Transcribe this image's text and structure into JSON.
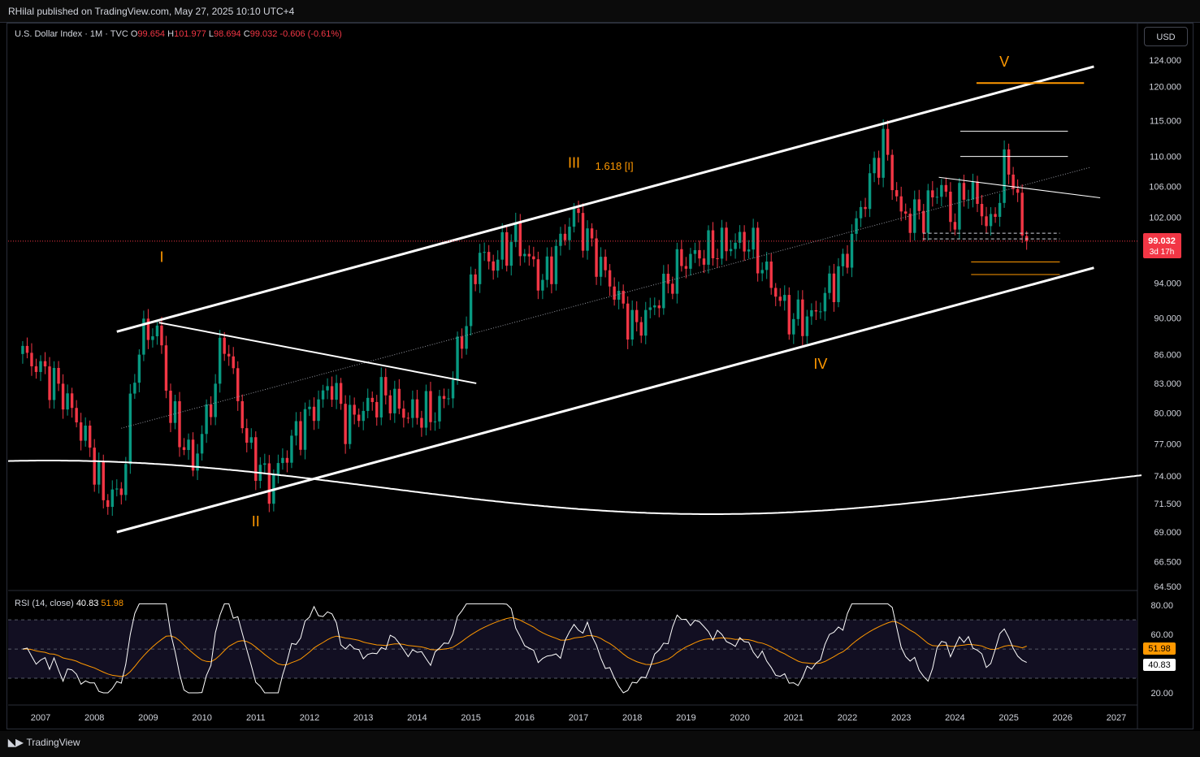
{
  "header": {
    "publisher_text": "RHilal published on TradingView.com, May 27, 2025 10:10 UTC+4"
  },
  "legend": {
    "symbol": "U.S. Dollar Index · 1M · TVC",
    "open_label": "O",
    "open": "99.654",
    "high_label": "H",
    "high": "101.977",
    "low_label": "L",
    "low": "98.694",
    "close_label": "C",
    "close": "99.032",
    "change": "-0.606 (-0.61%)"
  },
  "currency_button": "USD",
  "price_tag": {
    "value": "99.032",
    "countdown": "3d 17h"
  },
  "rsi_legend": {
    "label": "RSI (14, close)",
    "rsi": "40.83",
    "ma": "51.98"
  },
  "rsi_tags": {
    "ma": "51.98",
    "rsi": "40.83"
  },
  "footer": {
    "brand": "TradingView"
  },
  "colors": {
    "up": "#089981",
    "down": "#f23645",
    "wave": "#ff9800",
    "rsi": "#ffffff",
    "rsi_ma": "#ff9800",
    "background": "#000000"
  },
  "chart_data": {
    "type": "candlestick",
    "symbol": "U.S. Dollar Index",
    "timeframe": "1M",
    "y_scale": "log",
    "ylim": [
      64.5,
      126
    ],
    "price_ticks": [
      "124.000",
      "120.000",
      "115.000",
      "110.000",
      "106.000",
      "102.000",
      "98.000",
      "94.000",
      "90.000",
      "86.000",
      "83.000",
      "80.000",
      "77.000",
      "74.000",
      "71.500",
      "69.000",
      "66.500",
      "64.500"
    ],
    "x_ticks": [
      "2007",
      "2008",
      "2009",
      "2010",
      "2011",
      "2012",
      "2013",
      "2014",
      "2015",
      "2016",
      "2017",
      "2018",
      "2019",
      "2020",
      "2021",
      "2022",
      "2023",
      "2024",
      "2025",
      "2026",
      "2027"
    ],
    "last_price": 99.032,
    "price_path": [
      [
        "2006-09",
        86.0
      ],
      [
        "2007-01",
        84.5
      ],
      [
        "2007-06",
        82.0
      ],
      [
        "2007-12",
        76.5
      ],
      [
        "2008-03",
        72.0
      ],
      [
        "2008-07",
        72.5
      ],
      [
        "2008-11",
        87.5
      ],
      [
        "2009-03",
        89.0
      ],
      [
        "2009-06",
        80.0
      ],
      [
        "2009-11",
        75.0
      ],
      [
        "2010-03",
        81.0
      ],
      [
        "2010-06",
        88.0
      ],
      [
        "2010-11",
        77.0
      ],
      [
        "2011-04",
        73.0
      ],
      [
        "2011-10",
        78.0
      ],
      [
        "2012-06",
        83.0
      ],
      [
        "2012-09",
        79.0
      ],
      [
        "2013-06",
        82.0
      ],
      [
        "2013-10",
        80.0
      ],
      [
        "2014-05",
        80.0
      ],
      [
        "2014-08",
        82.0
      ],
      [
        "2014-12",
        90.0
      ],
      [
        "2015-03",
        98.0
      ],
      [
        "2015-05",
        96.0
      ],
      [
        "2015-11",
        99.5
      ],
      [
        "2016-05",
        94.0
      ],
      [
        "2016-12",
        102.5
      ],
      [
        "2017-06",
        96.0
      ],
      [
        "2018-01",
        89.0
      ],
      [
        "2018-04",
        90.0
      ],
      [
        "2018-12",
        96.5
      ],
      [
        "2019-09",
        98.5
      ],
      [
        "2020-03",
        99.0
      ],
      [
        "2020-12",
        90.0
      ],
      [
        "2021-05",
        90.0
      ],
      [
        "2021-12",
        96.0
      ],
      [
        "2022-04",
        103.0
      ],
      [
        "2022-09",
        112.0
      ],
      [
        "2023-01",
        102.0
      ],
      [
        "2023-06",
        102.5
      ],
      [
        "2023-10",
        106.5
      ],
      [
        "2023-12",
        101.5
      ],
      [
        "2024-04",
        106.0
      ],
      [
        "2024-09",
        100.5
      ],
      [
        "2024-12",
        108.0
      ],
      [
        "2025-01",
        109.0
      ],
      [
        "2025-03",
        104.0
      ],
      [
        "2025-04",
        99.5
      ],
      [
        "2025-05",
        99.032
      ]
    ],
    "annotations": [
      {
        "text": "I",
        "date": "2009-04",
        "price": 96.5
      },
      {
        "text": "II",
        "date": "2011-01",
        "price": 69.5
      },
      {
        "text": "III",
        "date": "2016-12",
        "price": 108.5
      },
      {
        "text": "1.618 [I]",
        "date": "2017-09",
        "price": 108.2
      },
      {
        "text": "IV",
        "date": "2021-07",
        "price": 84.5
      },
      {
        "text": "V",
        "date": "2024-12",
        "price": 123.0
      }
    ],
    "channel": {
      "upper": [
        [
          "2008-06",
          88.5
        ],
        [
          "2026-08",
          123.0
        ]
      ],
      "lower": [
        [
          "2008-06",
          69.0
        ],
        [
          "2026-08",
          95.8
        ]
      ]
    },
    "horizontal_levels": {
      "white": [
        113.5,
        110.0
      ],
      "orange": [
        120.5,
        96.5,
        95.0
      ]
    },
    "rsi": {
      "period": 14,
      "last": 40.83,
      "ma_last": 51.98,
      "bands": [
        70,
        50,
        30
      ],
      "ticks": [
        "80.00",
        "60.00",
        "20.00"
      ],
      "ylim": [
        15,
        84
      ]
    }
  }
}
